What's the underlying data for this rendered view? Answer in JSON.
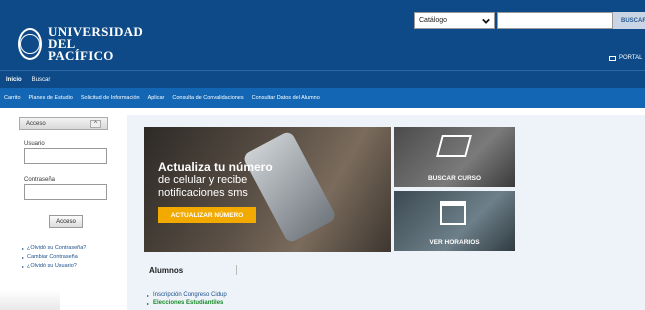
{
  "header": {
    "logo_line1": "UNIVERSIDAD",
    "logo_line2": "DEL PACÍFICO",
    "catalog_select": "Catálogo",
    "search_placeholder": "",
    "search_button": "BUSCAR",
    "portal_link": "PORTAL"
  },
  "nav_primary": [
    "Inicio",
    "Buscar"
  ],
  "nav_secondary": [
    "Carrito",
    "Planes de Estudio",
    "Solicitud de Información",
    "Aplicar",
    "Consulta de Convalidaciones",
    "Consultar Datos del Alumno"
  ],
  "sidebar": {
    "panel_title": "Acceso",
    "panel_caret": "^",
    "user_label": "Usuario",
    "password_label": "Contraseña",
    "login_button": "Acceso",
    "links": [
      "¿Olvidó su Contraseña?",
      "Cambiar Contraseña",
      "¿Olvidó su Usuario?"
    ]
  },
  "banner": {
    "title": "Actualiza tu número",
    "line2": "de celular y recibe",
    "line3": "notificaciones sms",
    "button": "ACTUALIZAR NÚMERO"
  },
  "tiles": {
    "buscar_curso": "BUSCAR CURSO",
    "ver_horarios": "VER HORARIOS"
  },
  "alumnos": {
    "title": "Alumnos",
    "links": [
      "Inscripción Congreso Cidup",
      "Elecciones Estudiantiles"
    ]
  },
  "colors": {
    "header_blue": "#0d4a87",
    "nav_blue": "#1266b4",
    "cta_yellow": "#f2a900",
    "link_green": "#1a8a2a"
  }
}
